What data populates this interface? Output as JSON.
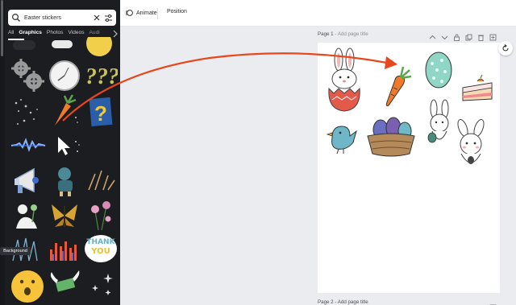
{
  "search": {
    "value": "Easter stickers"
  },
  "tabs": [
    {
      "label": "All"
    },
    {
      "label": "Graphics"
    },
    {
      "label": "Photos"
    },
    {
      "label": "Videos"
    },
    {
      "label": "Audi"
    }
  ],
  "tooltip": {
    "label": "Background"
  },
  "toolbar": {
    "animate_label": "Animate",
    "position_label": "Position"
  },
  "pages": [
    {
      "title": "Page 1",
      "placeholder": "Add page title"
    },
    {
      "title": "Page 2",
      "placeholder": "Add page title"
    }
  ],
  "stickers": {
    "thank_you_line1": "THANK",
    "thank_you_line2": "YOU"
  },
  "colors": {
    "panel_bg": "#1b1d21",
    "canvas_bg": "#ebecf0",
    "annotation_arrow": "#e8471d",
    "carrot": "#f07a2a"
  }
}
